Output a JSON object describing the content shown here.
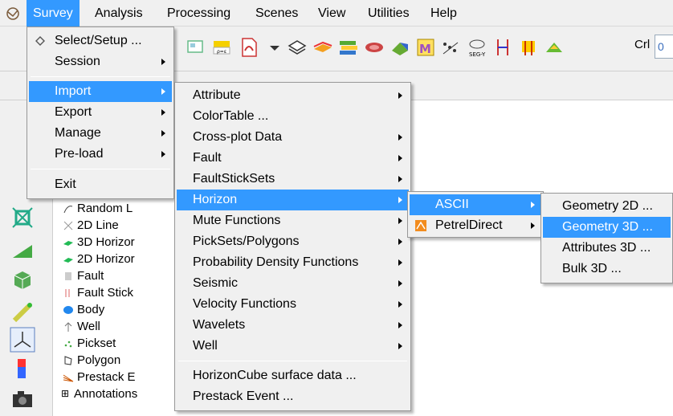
{
  "menubar": {
    "items": [
      {
        "label": "Survey"
      },
      {
        "label": "Analysis"
      },
      {
        "label": "Processing"
      },
      {
        "label": "Scenes"
      },
      {
        "label": "View"
      },
      {
        "label": "Utilities"
      },
      {
        "label": "Help"
      }
    ]
  },
  "toolbar": {
    "crl_label": "Crl",
    "crl_value": "0"
  },
  "tree": {
    "items": [
      {
        "label": "Random L"
      },
      {
        "label": "2D Line"
      },
      {
        "label": "3D Horizor"
      },
      {
        "label": "2D Horizor"
      },
      {
        "label": "Fault"
      },
      {
        "label": "Fault Stick"
      },
      {
        "label": "Body"
      },
      {
        "label": "Well"
      },
      {
        "label": "Pickset"
      },
      {
        "label": "Polygon"
      },
      {
        "label": "Prestack E"
      },
      {
        "label": "Annotations"
      }
    ],
    "expander": "⊞"
  },
  "survey_menu": {
    "items": [
      {
        "label": "Select/Setup ..."
      },
      {
        "label": "Session"
      },
      {
        "label": "Import"
      },
      {
        "label": "Export"
      },
      {
        "label": "Manage"
      },
      {
        "label": "Pre-load"
      },
      {
        "label": "Exit"
      }
    ]
  },
  "import_menu": {
    "items": [
      {
        "label": "Attribute"
      },
      {
        "label": "ColorTable ..."
      },
      {
        "label": "Cross-plot Data"
      },
      {
        "label": "Fault"
      },
      {
        "label": "FaultStickSets"
      },
      {
        "label": "Horizon"
      },
      {
        "label": "Mute Functions"
      },
      {
        "label": "PickSets/Polygons"
      },
      {
        "label": "Probability Density Functions"
      },
      {
        "label": "Seismic"
      },
      {
        "label": "Velocity Functions"
      },
      {
        "label": "Wavelets"
      },
      {
        "label": "Well"
      },
      {
        "label": "HorizonCube surface data ..."
      },
      {
        "label": "Prestack Event ..."
      }
    ]
  },
  "horizon_menu": {
    "items": [
      {
        "label": "ASCII"
      },
      {
        "label": "PetrelDirect"
      }
    ]
  },
  "ascii_menu": {
    "items": [
      {
        "label": "Geometry 2D ..."
      },
      {
        "label": "Geometry 3D ..."
      },
      {
        "label": "Attributes 3D ..."
      },
      {
        "label": "Bulk 3D ..."
      }
    ]
  },
  "colors": {
    "highlight": "#3399ff",
    "menu_bg": "#f0f0f0",
    "chrome": "#f0f0f0"
  }
}
